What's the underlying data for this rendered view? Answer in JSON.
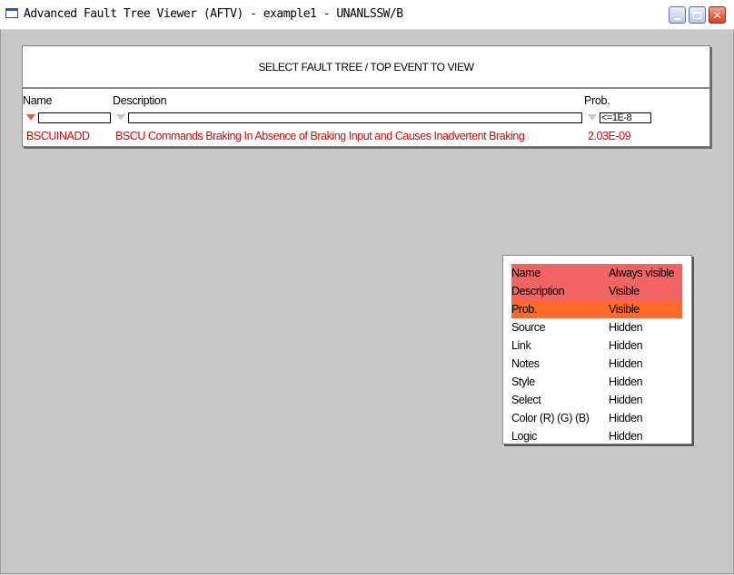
{
  "window": {
    "title": "Advanced Fault Tree Viewer (AFTV) - example1 - UNANLSSW/B",
    "controls": [
      "minimize",
      "maximize",
      "close"
    ]
  },
  "selector": {
    "title": "SELECT FAULT TREE / TOP EVENT TO VIEW",
    "columns": {
      "name": "Name",
      "description": "Description",
      "prob": "Prob."
    },
    "filters": {
      "name": "",
      "description": "",
      "prob": "<=1E-8"
    },
    "rows": [
      {
        "name": "BSCUINADD",
        "description": "BSCU Commands Braking In Absence of Braking Input and Causes Inadvertent Braking",
        "prob": "2.03E-09"
      }
    ]
  },
  "column_menu": {
    "items": [
      {
        "name": "Name",
        "state": "Always visible",
        "highlight": "#f06464"
      },
      {
        "name": "Description",
        "state": "Visible",
        "highlight": "#f06464"
      },
      {
        "name": "Prob.",
        "state": "Visible",
        "highlight": "#ff6a2a"
      },
      {
        "name": "Source",
        "state": "Hidden"
      },
      {
        "name": "Link",
        "state": "Hidden"
      },
      {
        "name": "Notes",
        "state": "Hidden"
      },
      {
        "name": "Style",
        "state": "Hidden"
      },
      {
        "name": "Select",
        "state": "Hidden"
      },
      {
        "name": "Color (R) (G) (B)",
        "state": "Hidden"
      },
      {
        "name": "Logic",
        "state": "Hidden"
      }
    ]
  },
  "colors": {
    "row_text": "#e00000",
    "background": "#c8c8c8"
  }
}
